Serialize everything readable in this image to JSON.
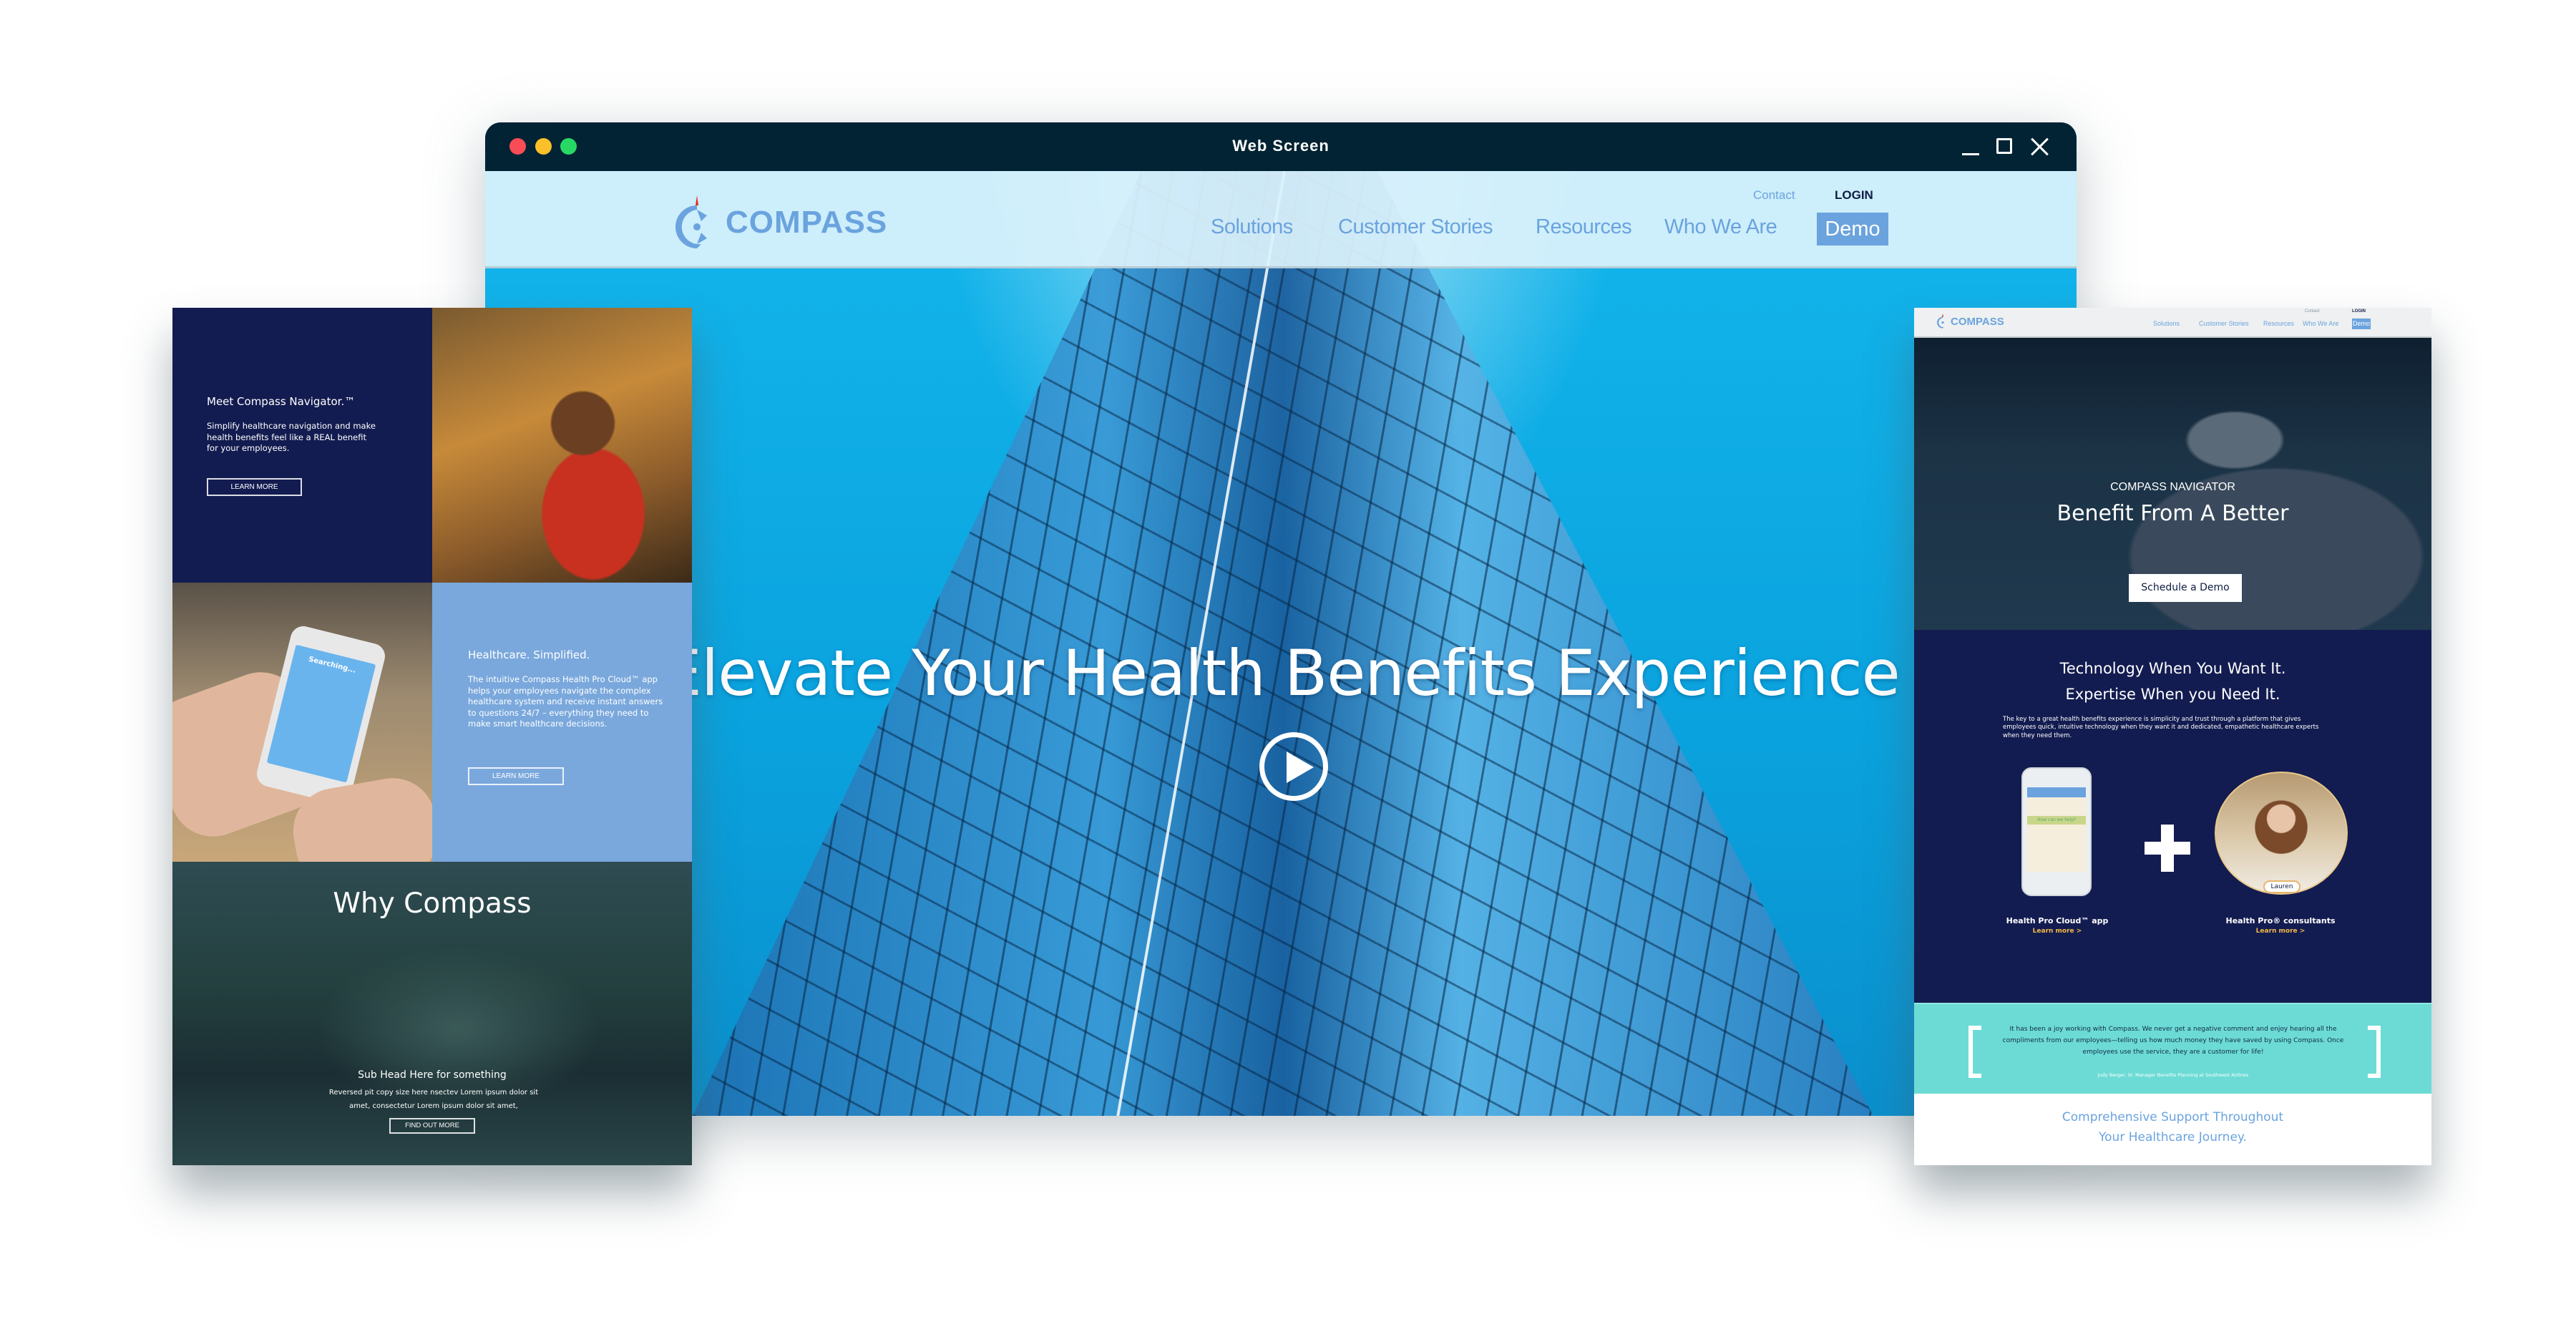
{
  "main_window": {
    "title": "Web Screen",
    "controls": {
      "minimize": "minimize",
      "maximize": "maximize",
      "close": "close"
    },
    "nav": {
      "logo_text": "COMPASS",
      "utility": {
        "contact": "Contact",
        "login": "LOGIN"
      },
      "links": [
        "Solutions",
        "Customer Stories",
        "Resources",
        "Who We Are"
      ],
      "cta": "Demo"
    },
    "hero": {
      "title": "Elevate Your Health Benefits Experience",
      "play_icon": "play-circle-icon"
    }
  },
  "left_panel": {
    "block1": {
      "heading": "Meet Compass Navigator.™",
      "body": "Simplify healthcare navigation and make health benefits feel like a REAL benefit for your employees.",
      "button": "LEARN MORE"
    },
    "block2": {
      "phone_search": "Searching...",
      "heading": "Healthcare. Simplified.",
      "body": "The intuitive Compass Health Pro Cloud™ app helps your employees navigate the complex healthcare system and receive instant answers to questions 24/7 – everything they need to make smart healthcare decisions.",
      "button": "LEARN MORE"
    },
    "block3": {
      "heading": "Why Compass",
      "subhead": "Sub Head Here for something",
      "body": "Reversed pit copy size here nsectev Lorem ipsum dolor sit amet, consectetur  Lorem ipsum dolor sit amet,",
      "button": "FIND OUT MORE"
    }
  },
  "right_panel": {
    "nav": {
      "logo_text": "COMPASS",
      "utility": {
        "contact": "Contact",
        "login": "LOGIN"
      },
      "links": [
        "Solutions",
        "Customer Stories",
        "Resources",
        "Who We Are"
      ],
      "cta": "Demo"
    },
    "hero": {
      "eyebrow": "COMPASS NAVIGATOR",
      "title": "Benefit From A Better",
      "button": "Schedule a Demo"
    },
    "tech": {
      "heading_line1": "Technology When You Want It.",
      "heading_line2": "Expertise When you Need It.",
      "body": "The key to a great health benefits experience is simplicity and trust through a platform that gives employees quick, intuitive technology when they want it and dedicated, empathetic healthcare experts when they need them.",
      "phone_prompt": "How can we help?",
      "consultant_name": "Lauren",
      "features": [
        {
          "caption": "Health Pro Cloud™ app",
          "link": "Learn more >"
        },
        {
          "caption": "Health Pro® consultants",
          "link": "Learn more >"
        }
      ]
    },
    "testimonial": {
      "quote": "It has been a joy working with Compass. We never get a negative comment and enjoy hearing all the compliments from our employees—telling us how much money they have saved by using Compass. Once employees use the service, they are a customer for life!",
      "citation": "Judy Berger, Sr. Manager Benefits Planning at Southwest Airlines"
    },
    "footer_heading_line1": "Comprehensive Support Throughout",
    "footer_heading_line2": "Your Healthcare Journey."
  },
  "colors": {
    "brand_blue": "#6aa3de",
    "navy": "#131c50",
    "titlebar": "#022333",
    "teal": "#6ddbd5",
    "gold_link": "#f2b84a"
  }
}
